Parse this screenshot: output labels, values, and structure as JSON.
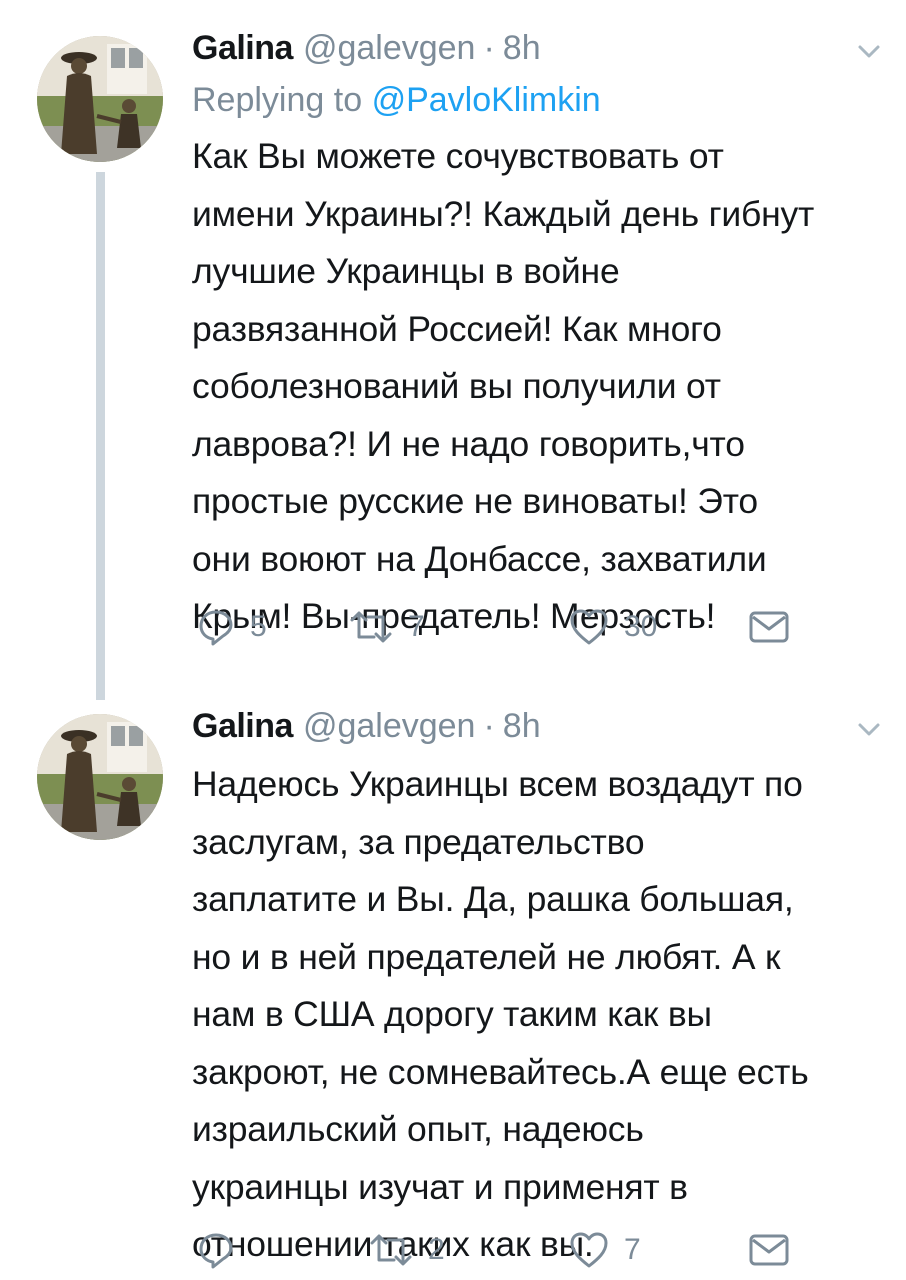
{
  "tweets": [
    {
      "display_name": "Galina",
      "handle": "@galevgen",
      "separator": "·",
      "time": "8h",
      "replying_prefix": "Replying to",
      "replying_to": "@PavloKlimkin",
      "text_lines": [
        "Как Вы можете сочувствовать от",
        "имени Украины?! Каждый день гибнут",
        "лучшие Украинцы в войне",
        "развязанной Россией! Как много",
        "соболезнований вы получили от",
        "лаврова?! И не надо говорить,что",
        "простые русские не виноваты! Это",
        "они воюют на Донбассе, захватили",
        "Крым! Вы-предатель! Мерзость!"
      ],
      "reply_count": "5",
      "retweet_count": "7",
      "like_count": "30"
    },
    {
      "display_name": "Galina",
      "handle": "@galevgen",
      "separator": "·",
      "time": "8h",
      "text_lines": [
        "Надеюсь Украинцы всем воздадут по",
        "заслугам, за предательство",
        "заплатите и Вы. Да, рашка большая,",
        "но и в ней предателей не любят. А к",
        "нам в США дорогу таким как вы",
        "закроют, не сомневайтесь.А еще есть",
        "израильский опыт, надеюсь",
        "украинцы изучат и применят в",
        "отношении таких как вы."
      ],
      "reply_count": "",
      "retweet_count": "2",
      "like_count": "7"
    }
  ],
  "colors": {
    "text": "#14171a",
    "muted": "#7c8b98",
    "link": "#1da1f2",
    "thread_line": "#cdd6dd"
  }
}
